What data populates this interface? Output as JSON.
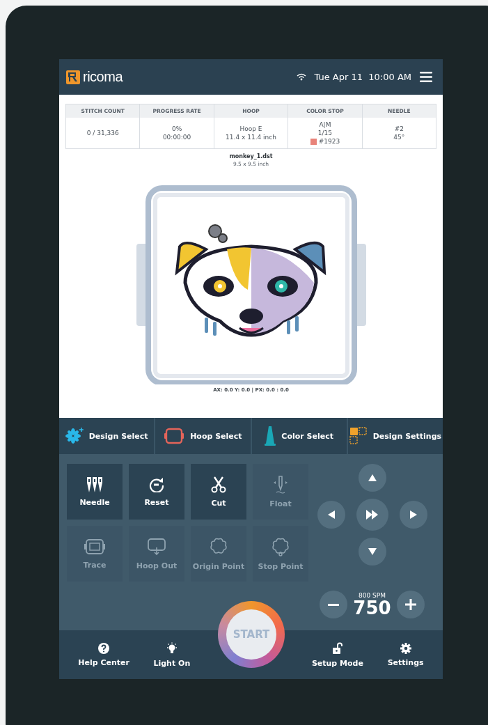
{
  "header": {
    "brand": "ricoma",
    "datetime": "Tue Apr 11  10:00 AM"
  },
  "info_table": {
    "columns": [
      {
        "heading": "STITCH COUNT",
        "lines": [
          "0 / 31,336"
        ]
      },
      {
        "heading": "PROGRESS RATE",
        "lines": [
          "0%",
          "00:00:00"
        ]
      },
      {
        "heading": "HOOP",
        "lines": [
          "Hoop E",
          "11.4 x 11.4 inch"
        ]
      },
      {
        "heading": "COLOR STOP",
        "lines": [
          "A|M",
          "1/15"
        ],
        "swatch": {
          "color": "#e8837a",
          "label": "#1923"
        }
      },
      {
        "heading": "NEEDLE",
        "lines": [
          "#2",
          "45°"
        ]
      }
    ]
  },
  "design": {
    "filename": "monkey_1.dst",
    "size": "9.5 x 9.5 inch",
    "coordinates": "AX: 0.0 Y: 0.0 | PX: 0.0 : 0.0"
  },
  "tabs": [
    {
      "label": "Design Select",
      "kind": "design"
    },
    {
      "label": "Hoop Select",
      "kind": "hoop"
    },
    {
      "label": "Color Select",
      "kind": "color"
    },
    {
      "label": "Design Settings",
      "kind": "settings"
    }
  ],
  "tools": [
    {
      "label": "Needle",
      "kind": "needle",
      "disabled": false
    },
    {
      "label": "Reset",
      "kind": "reset",
      "disabled": false
    },
    {
      "label": "Cut",
      "kind": "cut",
      "disabled": false
    },
    {
      "label": "Float",
      "kind": "float",
      "disabled": true
    },
    {
      "label": "Trace",
      "kind": "trace",
      "disabled": true
    },
    {
      "label": "Hoop Out",
      "kind": "hoop-out",
      "disabled": true
    },
    {
      "label": "Origin Point",
      "kind": "origin",
      "disabled": true
    },
    {
      "label": "Stop Point",
      "kind": "stop",
      "disabled": true
    }
  ],
  "speed": {
    "max": "800 SPM",
    "value": "750"
  },
  "start_button": {
    "label": "START"
  },
  "bottom_bar": {
    "left": [
      {
        "label": "Help Center",
        "kind": "help"
      },
      {
        "label": "Light On",
        "kind": "light"
      }
    ],
    "right": [
      {
        "label": "Setup Mode",
        "kind": "lock"
      },
      {
        "label": "Settings",
        "kind": "gear"
      }
    ]
  }
}
